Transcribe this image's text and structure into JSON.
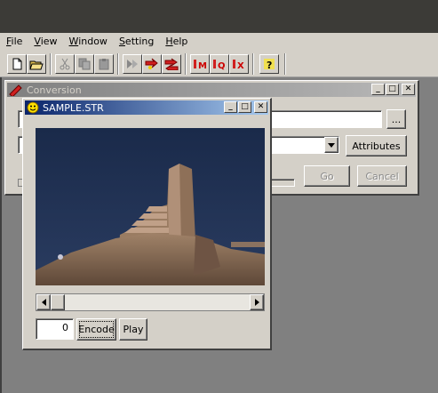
{
  "menu": [
    "File",
    "View",
    "Window",
    "Setting",
    "Help"
  ],
  "menu_underline": [
    "F",
    "V",
    "W",
    "S",
    "H"
  ],
  "menu_rest": [
    "ile",
    "iew",
    "indow",
    "etting",
    "elp"
  ],
  "toolbar": {
    "icons": [
      "new-file-icon",
      "open-folder-icon",
      "cut-icon",
      "copy-icon",
      "paste-icon",
      "convert-icon",
      "convert-star-icon",
      "convert-red-icon",
      "mdec-m-icon",
      "mdec-q-icon",
      "mdec-x-icon",
      "help-icon"
    ]
  },
  "conversion": {
    "title": "Conversion",
    "browse_label": "...",
    "attributes_label": "Attributes",
    "go_label": "Go",
    "cancel_label": "Cancel"
  },
  "sample": {
    "title": "SAMPLE.STR",
    "frame_value": "0",
    "encode_label": "Encode",
    "play_label": "Play"
  },
  "colors": {
    "titlebar_active": "#0a246a",
    "titlebar_inactive": "#808080",
    "face": "#d4d0c8"
  }
}
